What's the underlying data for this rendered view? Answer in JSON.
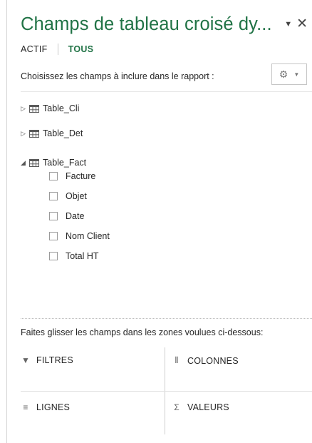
{
  "pane": {
    "title": "Champs de tableau croisé dy...",
    "tabs": [
      {
        "label": "ACTIF"
      },
      {
        "label": "TOUS"
      }
    ],
    "choose_label": "Choisissez les champs à inclure dans le rapport :",
    "tables": [
      {
        "name": "Table_Cli",
        "expanded": false
      },
      {
        "name": "Table_Det",
        "expanded": false
      },
      {
        "name": "Table_Fact",
        "expanded": true,
        "fields": [
          "Facture",
          "Objet",
          "Date",
          "Nom Client",
          "Total HT"
        ]
      }
    ],
    "drag_label": "Faites glisser les champs dans les zones voulues ci-dessous:",
    "zones": {
      "filters": "FILTRES",
      "columns": "COLONNES",
      "rows": "LIGNES",
      "values": "VALEURS"
    },
    "accent_color": "#217346",
    "icons": [
      "chevron-down-icon",
      "close-icon",
      "gear-icon",
      "table-icon",
      "filter-icon",
      "columns-icon",
      "rows-icon",
      "sigma-icon"
    ]
  }
}
